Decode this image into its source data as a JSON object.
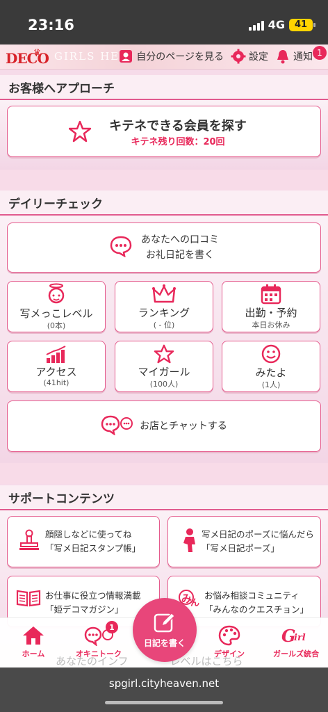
{
  "status_bar": {
    "time": "23:16",
    "network": "4G",
    "battery": "41"
  },
  "header": {
    "logo": "DECO",
    "brand_text": "GIRLS HE",
    "my_page": "自分のページを見る",
    "settings": "設定",
    "notifications": "通知",
    "notification_count": "1"
  },
  "approach": {
    "title": "お客様へアプローチ",
    "search_label": "キテネできる会員を探す",
    "remaining": "キテネ残り回数：20回"
  },
  "daily": {
    "title": "デイリーチェック",
    "review_line1": "あなたへの口コミ",
    "review_line2": "お礼日記を書く",
    "tiles": [
      {
        "label": "写メっこレベル",
        "sub": "(0本)"
      },
      {
        "label": "ランキング",
        "sub": "( - 位)"
      },
      {
        "label": "出勤・予約",
        "sub": "本日お休み"
      },
      {
        "label": "アクセス",
        "sub": "(41hit)"
      },
      {
        "label": "マイガール",
        "sub": "(100人)"
      },
      {
        "label": "みたよ",
        "sub": "(1人)"
      }
    ],
    "chat": "お店とチャットする"
  },
  "support": {
    "title": "サポートコンテンツ",
    "items": [
      {
        "line1": "顔隠しなどに使ってね",
        "line2": "「写メ日記スタンプ帳」"
      },
      {
        "line1": "写メ日記のポーズに悩んだら",
        "line2": "「写メ日記ポーズ」"
      },
      {
        "line1": "お仕事に役立つ情報満載",
        "line2": "「姫デコマガジン」"
      },
      {
        "line1": "お悩み相談コミュニティ",
        "line2": "「みんなのクエスチョン」"
      }
    ],
    "ghost": "あなたのインフ　　　　レベルはこちら"
  },
  "bottom_nav": {
    "home": "ホーム",
    "okini_talk": "オキニトーク",
    "okini_badge": "1",
    "write_diary": "日記を書く",
    "design": "デザイン",
    "girls": "ガールズ統合"
  },
  "url": "spgirl.cityheaven.net",
  "colors": {
    "accent": "#e8285a",
    "border": "#e45a8c",
    "status": "#3a3a3a"
  }
}
